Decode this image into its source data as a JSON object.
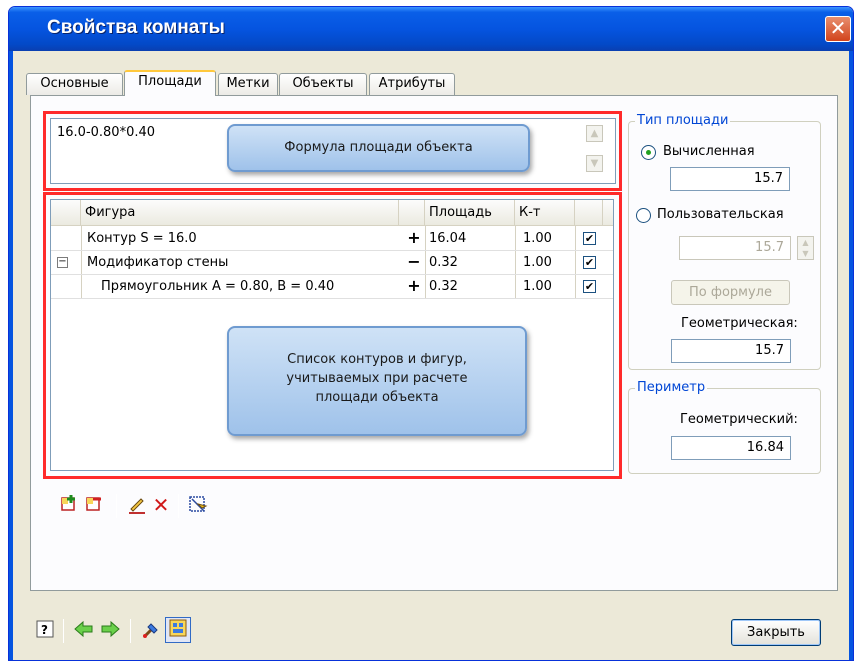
{
  "window": {
    "title": "Свойства комнаты",
    "close_glyph": "✕"
  },
  "tabs": [
    {
      "label": "Основные",
      "active": false
    },
    {
      "label": "Площади",
      "active": true
    },
    {
      "label": "Метки",
      "active": false
    },
    {
      "label": "Объекты",
      "active": false
    },
    {
      "label": "Атрибуты",
      "active": false
    }
  ],
  "formula": {
    "text": "16.0-0.80*0.40"
  },
  "callouts": {
    "formula": "Формула площади объекта",
    "list_lines": [
      "Список контуров и фигур,",
      "учитываемых при расчете",
      "площади объекта"
    ]
  },
  "grid": {
    "columns": {
      "figure": "Фигура",
      "area": "Площадь",
      "coef": "К-т"
    },
    "rows": [
      {
        "figure": "Контур S = 16.0",
        "sign": "+",
        "area": "16.04",
        "coef": "1.00",
        "checked": "✔",
        "expander": ""
      },
      {
        "figure": "Модификатор стены",
        "sign": "−",
        "area": "0.32",
        "coef": "1.00",
        "checked": "✔",
        "expander": "−"
      },
      {
        "figure": "Прямоугольник A = 0.80, B = 0.40",
        "sign": "+",
        "area": "0.32",
        "coef": "1.00",
        "checked": "✔",
        "expander": ""
      }
    ]
  },
  "area_type": {
    "title": "Тип площади",
    "calculated_label": "Вычисленная",
    "calculated_value": "15.7",
    "custom_label": "Пользовательская",
    "custom_value": "15.7",
    "by_formula_button": "По формуле",
    "geometric_label": "Геометрическая:",
    "geometric_value": "15.7"
  },
  "perimeter": {
    "title": "Периметр",
    "geometric_label": "Геометрический:",
    "geometric_value": "16.84"
  },
  "footer": {
    "close_button": "Закрыть"
  },
  "icons": {
    "add_figure": "add-figure-icon",
    "remove_figure": "remove-figure-icon",
    "edit": "pencil-icon",
    "delete": "delete-icon",
    "select_region": "select-region-icon",
    "help": "help-icon",
    "back": "arrow-left-icon",
    "forward": "arrow-right-icon",
    "paint": "paint-icon",
    "layout": "layout-icon"
  },
  "colors": {
    "highlight_frame": "#ff2a2a",
    "title_bar": "#0554e0",
    "group_title": "#0046d5"
  }
}
